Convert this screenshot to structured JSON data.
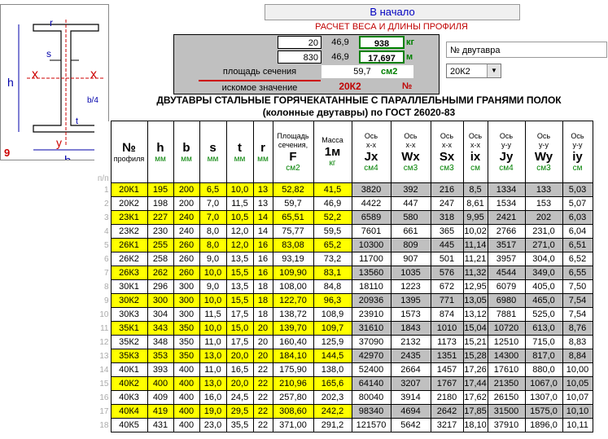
{
  "home_button": "В начало",
  "calc_title": "РАСЧЕТ ВЕСА И ДЛИНЫ ПРОФИЛЯ",
  "calc": {
    "r1": [
      "20",
      "46,9",
      "938",
      "кг"
    ],
    "r2": [
      "830",
      "46,9",
      "17,697",
      "м"
    ],
    "r3": [
      "площадь сечения",
      "59,7",
      "см2"
    ],
    "r4": [
      "искомое значение",
      "20К2",
      "№"
    ]
  },
  "profile_label": "№ двутавра",
  "profile_select": "20К2",
  "diagram": {
    "h": "h",
    "b": "b",
    "s": "s",
    "t": "t",
    "r": "r",
    "x": "x",
    "y": "y",
    "b4": "b/4",
    "num": "9"
  },
  "table_title_1": "ДВУТАВРЫ СТАЛЬНЫЕ ГОРЯЧЕКАТАННЫЕ С ПАРАЛЛЕЛЬНЫМИ ГРАНЯМИ ПОЛОК",
  "table_title_2": "(колонные двутавры) по ГОСТ 26020-83",
  "header": {
    "pp": "п/п",
    "no": "№",
    "profile": "профиля",
    "h": "h",
    "b": "b",
    "s": "s",
    "t": "t",
    "r": "r",
    "area_top": "Площадь",
    "area_mid": "сечения,",
    "area_sym": "F",
    "mass_top": "Масса",
    "mass_sym": "1м",
    "axis_xx": "Ось",
    "xx": "x-x",
    "yy": "y-y",
    "Jx": "Jx",
    "Wx": "Wx",
    "Sx": "Sx",
    "ix": "ix",
    "Jy": "Jy",
    "Wy": "Wy",
    "iy": "iy",
    "mm": "мм",
    "cm2": "см2",
    "kg": "кг",
    "cm4": "см4",
    "cm3": "см3",
    "cm": "см"
  },
  "rows": [
    [
      "1",
      "20К1",
      "195",
      "200",
      "6,5",
      "10,0",
      "13",
      "52,82",
      "41,5",
      "3820",
      "392",
      "216",
      "8,5",
      "1334",
      "133",
      "5,03"
    ],
    [
      "2",
      "20К2",
      "198",
      "200",
      "7,0",
      "11,5",
      "13",
      "59,7",
      "46,9",
      "4422",
      "447",
      "247",
      "8,61",
      "1534",
      "153",
      "5,07"
    ],
    [
      "3",
      "23К1",
      "227",
      "240",
      "7,0",
      "10,5",
      "14",
      "65,51",
      "52,2",
      "6589",
      "580",
      "318",
      "9,95",
      "2421",
      "202",
      "6,03"
    ],
    [
      "4",
      "23К2",
      "230",
      "240",
      "8,0",
      "12,0",
      "14",
      "75,77",
      "59,5",
      "7601",
      "661",
      "365",
      "10,02",
      "2766",
      "231,0",
      "6,04"
    ],
    [
      "5",
      "26К1",
      "255",
      "260",
      "8,0",
      "12,0",
      "16",
      "83,08",
      "65,2",
      "10300",
      "809",
      "445",
      "11,14",
      "3517",
      "271,0",
      "6,51"
    ],
    [
      "6",
      "26К2",
      "258",
      "260",
      "9,0",
      "13,5",
      "16",
      "93,19",
      "73,2",
      "11700",
      "907",
      "501",
      "11,21",
      "3957",
      "304,0",
      "6,52"
    ],
    [
      "7",
      "26К3",
      "262",
      "260",
      "10,0",
      "15,5",
      "16",
      "109,90",
      "83,1",
      "13560",
      "1035",
      "576",
      "11,32",
      "4544",
      "349,0",
      "6,55"
    ],
    [
      "8",
      "30К1",
      "296",
      "300",
      "9,0",
      "13,5",
      "18",
      "108,00",
      "84,8",
      "18110",
      "1223",
      "672",
      "12,95",
      "6079",
      "405,0",
      "7,50"
    ],
    [
      "9",
      "30К2",
      "300",
      "300",
      "10,0",
      "15,5",
      "18",
      "122,70",
      "96,3",
      "20936",
      "1395",
      "771",
      "13,05",
      "6980",
      "465,0",
      "7,54"
    ],
    [
      "10",
      "30К3",
      "304",
      "300",
      "11,5",
      "17,5",
      "18",
      "138,72",
      "108,9",
      "23910",
      "1573",
      "874",
      "13,12",
      "7881",
      "525,0",
      "7,54"
    ],
    [
      "11",
      "35К1",
      "343",
      "350",
      "10,0",
      "15,0",
      "20",
      "139,70",
      "109,7",
      "31610",
      "1843",
      "1010",
      "15,04",
      "10720",
      "613,0",
      "8,76"
    ],
    [
      "12",
      "35К2",
      "348",
      "350",
      "11,0",
      "17,5",
      "20",
      "160,40",
      "125,9",
      "37090",
      "2132",
      "1173",
      "15,21",
      "12510",
      "715,0",
      "8,83"
    ],
    [
      "13",
      "35К3",
      "353",
      "350",
      "13,0",
      "20,0",
      "20",
      "184,10",
      "144,5",
      "42970",
      "2435",
      "1351",
      "15,28",
      "14300",
      "817,0",
      "8,84"
    ],
    [
      "14",
      "40К1",
      "393",
      "400",
      "11,0",
      "16,5",
      "22",
      "175,90",
      "138,0",
      "52400",
      "2664",
      "1457",
      "17,26",
      "17610",
      "880,0",
      "10,00"
    ],
    [
      "15",
      "40К2",
      "400",
      "400",
      "13,0",
      "20,0",
      "22",
      "210,96",
      "165,6",
      "64140",
      "3207",
      "1767",
      "17,44",
      "21350",
      "1067,0",
      "10,05"
    ],
    [
      "16",
      "40К3",
      "409",
      "400",
      "16,0",
      "24,5",
      "22",
      "257,80",
      "202,3",
      "80040",
      "3914",
      "2180",
      "17,62",
      "26150",
      "1307,0",
      "10,07"
    ],
    [
      "17",
      "40К4",
      "419",
      "400",
      "19,0",
      "29,5",
      "22",
      "308,60",
      "242,2",
      "98340",
      "4694",
      "2642",
      "17,85",
      "31500",
      "1575,0",
      "10,10"
    ],
    [
      "18",
      "40К5",
      "431",
      "400",
      "23,0",
      "35,5",
      "22",
      "371,00",
      "291,2",
      "121570",
      "5642",
      "3217",
      "18,10",
      "37910",
      "1896,0",
      "10,11"
    ]
  ]
}
